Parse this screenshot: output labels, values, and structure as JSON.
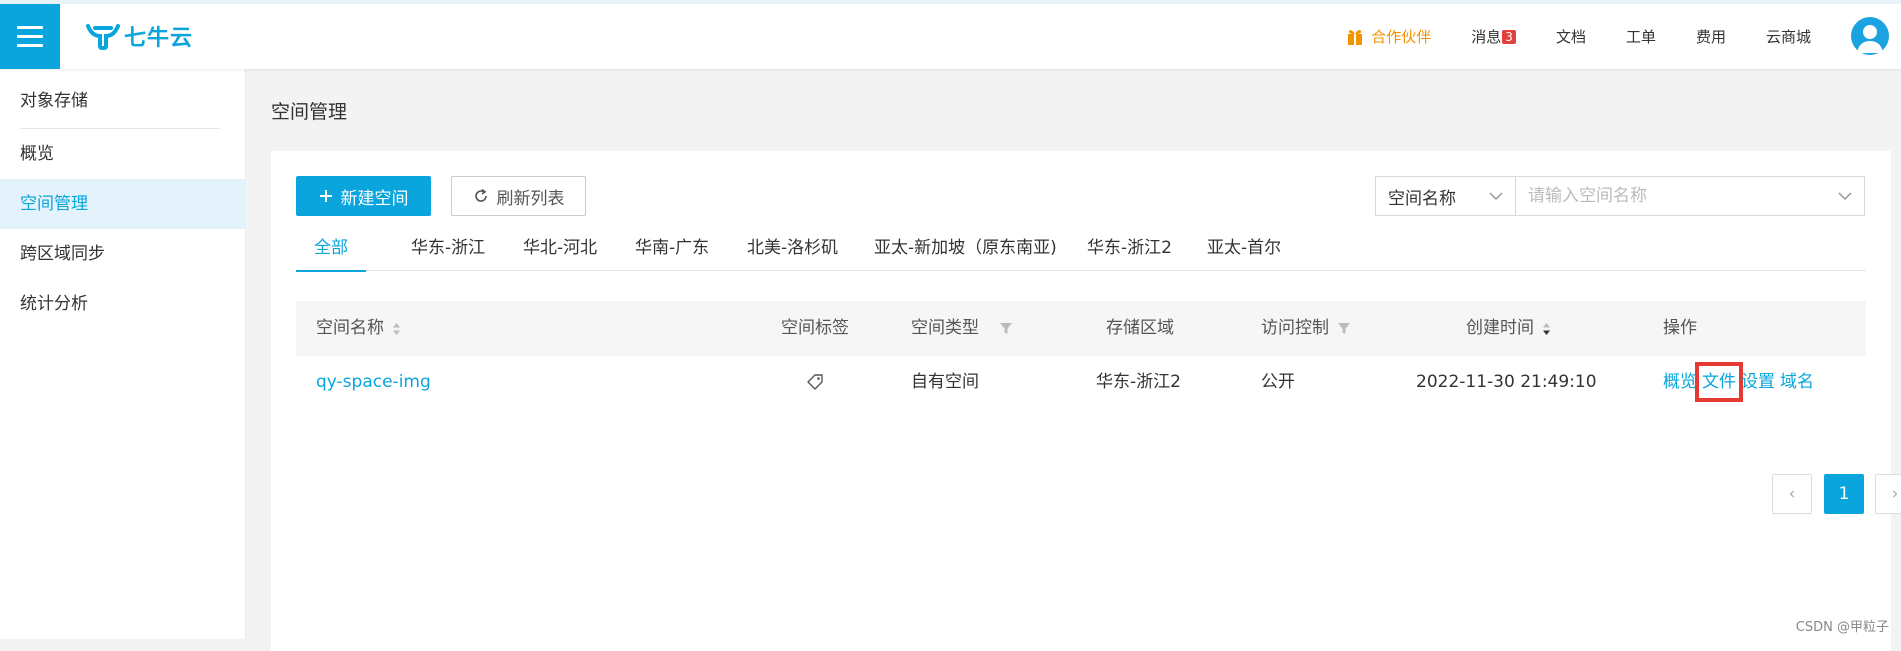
{
  "header": {
    "logo_text": "七牛云",
    "nav": {
      "partner": "合作伙伴",
      "messages": "消息",
      "messages_badge": "3",
      "docs": "文档",
      "tickets": "工单",
      "billing": "费用",
      "mall": "云商城"
    },
    "accent_color": "#09a5dc",
    "partner_color": "#f29300"
  },
  "sidebar": {
    "title": "对象存储",
    "items": [
      {
        "label": "概览",
        "active": false
      },
      {
        "label": "空间管理",
        "active": true
      },
      {
        "label": "跨区域同步",
        "active": false
      },
      {
        "label": "统计分析",
        "active": false
      }
    ]
  },
  "main": {
    "page_title": "空间管理",
    "toolbar": {
      "new_button": "新建空间",
      "refresh_button": "刷新列表"
    },
    "search": {
      "field_select": "空间名称",
      "placeholder": "请输入空间名称"
    },
    "tabs": [
      {
        "label": "全部",
        "active": true
      },
      {
        "label": "华东-浙江",
        "active": false
      },
      {
        "label": "华北-河北",
        "active": false
      },
      {
        "label": "华南-广东",
        "active": false
      },
      {
        "label": "北美-洛杉矶",
        "active": false
      },
      {
        "label": "亚太-新加坡（原东南亚)",
        "active": false
      },
      {
        "label": "华东-浙江2",
        "active": false
      },
      {
        "label": "亚太-首尔",
        "active": false
      }
    ],
    "table": {
      "columns": [
        "空间名称",
        "空间标签",
        "空间类型",
        "存储区域",
        "访问控制",
        "创建时间",
        "操作"
      ],
      "rows": [
        {
          "name": "qy-space-img",
          "tag_icon": "tag-icon",
          "type": "自有空间",
          "region": "华东-浙江2",
          "access": "公开",
          "created": "2022-11-30 21:49:10",
          "actions": [
            "概览",
            "文件",
            "设置",
            "域名"
          ]
        }
      ]
    },
    "pagination": {
      "prev": "‹",
      "current": "1",
      "next": "›"
    }
  },
  "watermark": "CSDN @甲粒子"
}
